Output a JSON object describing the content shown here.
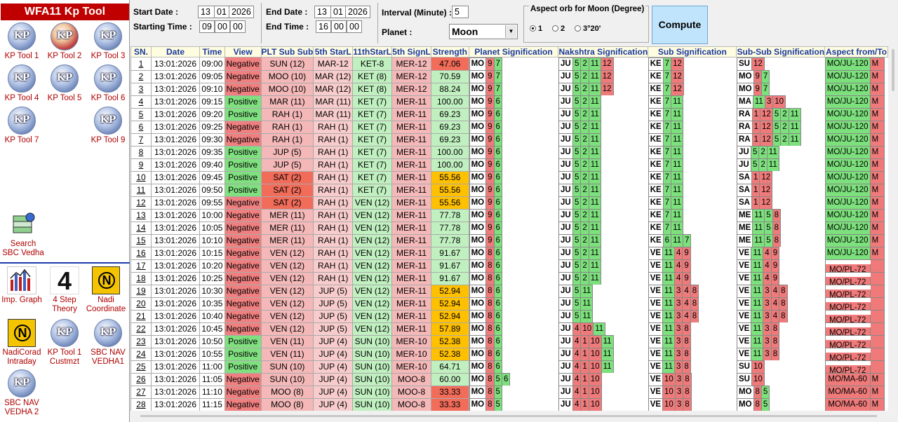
{
  "sidebar": {
    "title": "WFA11 Kp Tool",
    "tools": [
      {
        "label": "KP Tool 1"
      },
      {
        "label": "KP Tool 2"
      },
      {
        "label": "KP Tool 3"
      },
      {
        "label": "KP Tool 4"
      },
      {
        "label": "KP Tool 5"
      },
      {
        "label": "KP Tool 6"
      },
      {
        "label": "KP Tool 7"
      },
      {
        "label": "KP Tool 9"
      }
    ],
    "search_label_1": "Search",
    "search_label_2": "SBC Vedha",
    "bottom": [
      {
        "label1": "Imp. Graph",
        "label2": ""
      },
      {
        "label1": "4 Step",
        "label2": "Theory"
      },
      {
        "label1": "Nadi",
        "label2": "Coordinate"
      },
      {
        "label1": "NadiCorad",
        "label2": "Intraday"
      },
      {
        "label1": "KP Tool 1",
        "label2": "Custmzt"
      },
      {
        "label1": "SBC NAV",
        "label2": "VEDHA1"
      },
      {
        "label1": "SBC NAV",
        "label2": "VEDHA 2"
      }
    ],
    "kp_text": "KP",
    "four_text": "4",
    "n_text": "N"
  },
  "form": {
    "start_date_label": "Start Date :",
    "start_d": "13",
    "start_m": "01",
    "start_y": "2026",
    "starting_time_label": "Starting Time :",
    "start_h": "09",
    "start_min": "00",
    "start_s": "00",
    "end_date_label": "End Date :",
    "end_d": "13",
    "end_m": "01",
    "end_y": "2026",
    "end_time_label": "End Time :",
    "end_h": "16",
    "end_min": "00",
    "end_s": "00",
    "interval_label": "Interval (Minute) :",
    "interval": "5",
    "planet_label": "Planet :",
    "planet": "Moon",
    "orb_legend": "Aspect orb for Moon (Degree)",
    "orb_options": [
      "1",
      "2",
      "3°20'"
    ],
    "orb_selected": "1",
    "compute_label": "Compute"
  },
  "table": {
    "headers": [
      "SN.",
      "Date",
      "Time",
      "View",
      "PLT Sub",
      "Sub",
      "5th StarL",
      "11thStarL",
      "5th SignL",
      "Strength",
      "Planet Signification",
      "Nakshtra Signification",
      "Sub Signification",
      "Sub-Sub Signification",
      "Aspect from/To"
    ],
    "rows": [
      {
        "sn": "1",
        "date": "13:01:2026",
        "time": "09:00",
        "view": "Negative",
        "plt": "SUN (12)",
        "s5": "MAR-12",
        "s11": "KET-8",
        "sg5": "MER-12",
        "str": "47.06"
      },
      {
        "sn": "2",
        "date": "13:01:2026",
        "time": "09:05",
        "view": "Negative",
        "plt": "MOO (10)",
        "s5": "MAR (12)",
        "s11": "KET (8)",
        "sg5": "MER-12",
        "str": "70.59"
      },
      {
        "sn": "3",
        "date": "13:01:2026",
        "time": "09:10",
        "view": "Negative",
        "plt": "MOO (10)",
        "s5": "MAR (12)",
        "s11": "KET (8)",
        "sg5": "MER-12",
        "str": "88.24"
      },
      {
        "sn": "4",
        "date": "13:01:2026",
        "time": "09:15",
        "view": "Positive",
        "plt": "MAR (11)",
        "s5": "MAR (11)",
        "s11": "KET (7)",
        "sg5": "MER-11",
        "str": "100.00"
      },
      {
        "sn": "5",
        "date": "13:01:2026",
        "time": "09:20",
        "view": "Positive",
        "plt": "RAH (1)",
        "s5": "MAR (11)",
        "s11": "KET (7)",
        "sg5": "MER-11",
        "str": "69.23"
      },
      {
        "sn": "6",
        "date": "13:01:2026",
        "time": "09:25",
        "view": "Negative",
        "plt": "RAH (1)",
        "s5": "RAH (1)",
        "s11": "KET (7)",
        "sg5": "MER-11",
        "str": "69.23"
      },
      {
        "sn": "7",
        "date": "13:01:2026",
        "time": "09:30",
        "view": "Negative",
        "plt": "RAH (1)",
        "s5": "RAH (1)",
        "s11": "KET (7)",
        "sg5": "MER-11",
        "str": "69.23"
      },
      {
        "sn": "8",
        "date": "13:01:2026",
        "time": "09:35",
        "view": "Positive",
        "plt": "JUP (5)",
        "s5": "RAH (1)",
        "s11": "KET (7)",
        "sg5": "MER-11",
        "str": "100.00"
      },
      {
        "sn": "9",
        "date": "13:01:2026",
        "time": "09:40",
        "view": "Positive",
        "plt": "JUP (5)",
        "s5": "RAH (1)",
        "s11": "KET (7)",
        "sg5": "MER-11",
        "str": "100.00"
      },
      {
        "sn": "10",
        "date": "13:01:2026",
        "time": "09:45",
        "view": "Positive",
        "plt": "SAT (2)",
        "s5": "RAH (1)",
        "s11": "KET (7)",
        "sg5": "MER-11",
        "str": "55.56"
      },
      {
        "sn": "11",
        "date": "13:01:2026",
        "time": "09:50",
        "view": "Positive",
        "plt": "SAT (2)",
        "s5": "RAH (1)",
        "s11": "KET (7)",
        "sg5": "MER-11",
        "str": "55.56"
      },
      {
        "sn": "12",
        "date": "13:01:2026",
        "time": "09:55",
        "view": "Negative",
        "plt": "SAT (2)",
        "s5": "RAH (1)",
        "s11": "VEN (12)",
        "sg5": "MER-11",
        "str": "55.56"
      },
      {
        "sn": "13",
        "date": "13:01:2026",
        "time": "10:00",
        "view": "Negative",
        "plt": "MER (11)",
        "s5": "RAH (1)",
        "s11": "VEN (12)",
        "sg5": "MER-11",
        "str": "77.78"
      },
      {
        "sn": "14",
        "date": "13:01:2026",
        "time": "10:05",
        "view": "Negative",
        "plt": "MER (11)",
        "s5": "RAH (1)",
        "s11": "VEN (12)",
        "sg5": "MER-11",
        "str": "77.78"
      },
      {
        "sn": "15",
        "date": "13:01:2026",
        "time": "10:10",
        "view": "Negative",
        "plt": "MER (11)",
        "s5": "RAH (1)",
        "s11": "VEN (12)",
        "sg5": "MER-11",
        "str": "77.78"
      },
      {
        "sn": "16",
        "date": "13:01:2026",
        "time": "10:15",
        "view": "Negative",
        "plt": "VEN (12)",
        "s5": "RAH (1)",
        "s11": "VEN (12)",
        "sg5": "MER-11",
        "str": "91.67"
      },
      {
        "sn": "17",
        "date": "13:01:2026",
        "time": "10:20",
        "view": "Negative",
        "plt": "VEN (12)",
        "s5": "RAH (1)",
        "s11": "VEN (12)",
        "sg5": "MER-11",
        "str": "91.67"
      },
      {
        "sn": "18",
        "date": "13:01:2026",
        "time": "10:25",
        "view": "Negative",
        "plt": "VEN (12)",
        "s5": "RAH (1)",
        "s11": "VEN (12)",
        "sg5": "MER-11",
        "str": "91.67"
      },
      {
        "sn": "19",
        "date": "13:01:2026",
        "time": "10:30",
        "view": "Negative",
        "plt": "VEN (12)",
        "s5": "JUP (5)",
        "s11": "VEN (12)",
        "sg5": "MER-11",
        "str": "52.94"
      },
      {
        "sn": "20",
        "date": "13:01:2026",
        "time": "10:35",
        "view": "Negative",
        "plt": "VEN (12)",
        "s5": "JUP (5)",
        "s11": "VEN (12)",
        "sg5": "MER-11",
        "str": "52.94"
      },
      {
        "sn": "21",
        "date": "13:01:2026",
        "time": "10:40",
        "view": "Negative",
        "plt": "VEN (12)",
        "s5": "JUP (5)",
        "s11": "VEN (12)",
        "sg5": "MER-11",
        "str": "52.94"
      },
      {
        "sn": "22",
        "date": "13:01:2026",
        "time": "10:45",
        "view": "Negative",
        "plt": "VEN (12)",
        "s5": "JUP (5)",
        "s11": "VEN (12)",
        "sg5": "MER-11",
        "str": "57.89"
      },
      {
        "sn": "23",
        "date": "13:01:2026",
        "time": "10:50",
        "view": "Positive",
        "plt": "VEN (11)",
        "s5": "JUP (4)",
        "s11": "SUN (10)",
        "sg5": "MER-10",
        "str": "52.38"
      },
      {
        "sn": "24",
        "date": "13:01:2026",
        "time": "10:55",
        "view": "Positive",
        "plt": "VEN (11)",
        "s5": "JUP (4)",
        "s11": "SUN (10)",
        "sg5": "MER-10",
        "str": "52.38"
      },
      {
        "sn": "25",
        "date": "13:01:2026",
        "time": "11:00",
        "view": "Positive",
        "plt": "SUN (10)",
        "s5": "JUP (4)",
        "s11": "SUN (10)",
        "sg5": "MER-10",
        "str": "64.71"
      },
      {
        "sn": "26",
        "date": "13:01:2026",
        "time": "11:05",
        "view": "Negative",
        "plt": "SUN (10)",
        "s5": "JUP (4)",
        "s11": "SUN (10)",
        "sg5": "MOO-8",
        "str": "60.00"
      },
      {
        "sn": "27",
        "date": "13:01:2026",
        "time": "11:10",
        "view": "Negative",
        "plt": "MOO (8)",
        "s5": "JUP (4)",
        "s11": "SUN (10)",
        "sg5": "MOO-8",
        "str": "33.33"
      },
      {
        "sn": "28",
        "date": "13:01:2026",
        "time": "11:15",
        "view": "Negative",
        "plt": "MOO (8)",
        "s5": "JUP (4)",
        "s11": "SUN (10)",
        "sg5": "MOO-8",
        "str": "33.33"
      }
    ],
    "planet_sig": [
      [
        "MO",
        "9",
        "7"
      ],
      [
        "MO",
        "9",
        "7"
      ],
      [
        "MO",
        "9",
        "7"
      ],
      [
        "MO",
        "9",
        "6"
      ],
      [
        "MO",
        "9",
        "6"
      ],
      [
        "MO",
        "9",
        "6"
      ],
      [
        "MO",
        "9",
        "6"
      ],
      [
        "MO",
        "9",
        "6"
      ],
      [
        "MO",
        "9",
        "6"
      ],
      [
        "MO",
        "9",
        "6"
      ],
      [
        "MO",
        "9",
        "6"
      ],
      [
        "MO",
        "9",
        "6"
      ],
      [
        "MO",
        "9",
        "6"
      ],
      [
        "MO",
        "9",
        "6"
      ],
      [
        "MO",
        "9",
        "6"
      ],
      [
        "MO",
        "8",
        "6"
      ],
      [
        "MO",
        "8",
        "6"
      ],
      [
        "MO",
        "8",
        "6"
      ],
      [
        "MO",
        "8",
        "6"
      ],
      [
        "MO",
        "8",
        "6"
      ],
      [
        "MO",
        "8",
        "6"
      ],
      [
        "MO",
        "8",
        "6"
      ],
      [
        "MO",
        "8",
        "6"
      ],
      [
        "MO",
        "8",
        "6"
      ],
      [
        "MO",
        "8",
        "6"
      ],
      [
        "MO",
        "8",
        "5",
        "6"
      ],
      [
        "MO",
        "8",
        "5"
      ],
      [
        "MO",
        "8",
        "5"
      ]
    ],
    "nak_sig": [
      [
        "JU",
        "5",
        "2",
        "11",
        "12"
      ],
      [
        "JU",
        "5",
        "2",
        "11",
        "12"
      ],
      [
        "JU",
        "5",
        "2",
        "11",
        "12"
      ],
      [
        "JU",
        "5",
        "2",
        "11"
      ],
      [
        "JU",
        "5",
        "2",
        "11"
      ],
      [
        "JU",
        "5",
        "2",
        "11"
      ],
      [
        "JU",
        "5",
        "2",
        "11"
      ],
      [
        "JU",
        "5",
        "2",
        "11"
      ],
      [
        "JU",
        "5",
        "2",
        "11"
      ],
      [
        "JU",
        "5",
        "2",
        "11"
      ],
      [
        "JU",
        "5",
        "2",
        "11"
      ],
      [
        "JU",
        "5",
        "2",
        "11"
      ],
      [
        "JU",
        "5",
        "2",
        "11"
      ],
      [
        "JU",
        "5",
        "2",
        "11"
      ],
      [
        "JU",
        "5",
        "2",
        "11"
      ],
      [
        "JU",
        "5",
        "2",
        "11"
      ],
      [
        "JU",
        "5",
        "2",
        "11"
      ],
      [
        "JU",
        "5",
        "2",
        "11"
      ],
      [
        "JU",
        "5",
        "11"
      ],
      [
        "JU",
        "5",
        "11"
      ],
      [
        "JU",
        "5",
        "11"
      ],
      [
        "JU",
        "4",
        "10",
        "11"
      ],
      [
        "JU",
        "4",
        "1",
        "10",
        "11"
      ],
      [
        "JU",
        "4",
        "1",
        "10",
        "11"
      ],
      [
        "JU",
        "4",
        "1",
        "10",
        "11"
      ],
      [
        "JU",
        "4",
        "1",
        "10"
      ],
      [
        "JU",
        "4",
        "1",
        "10"
      ],
      [
        "JU",
        "4",
        "1",
        "10"
      ]
    ],
    "sub_sig": [
      [
        "KE",
        "7",
        "12"
      ],
      [
        "KE",
        "7",
        "12"
      ],
      [
        "KE",
        "7",
        "12"
      ],
      [
        "KE",
        "7",
        "11"
      ],
      [
        "KE",
        "7",
        "11"
      ],
      [
        "KE",
        "7",
        "11"
      ],
      [
        "KE",
        "7",
        "11"
      ],
      [
        "KE",
        "7",
        "11"
      ],
      [
        "KE",
        "7",
        "11"
      ],
      [
        "KE",
        "7",
        "11"
      ],
      [
        "KE",
        "7",
        "11"
      ],
      [
        "KE",
        "7",
        "11"
      ],
      [
        "KE",
        "7",
        "11"
      ],
      [
        "KE",
        "7",
        "11"
      ],
      [
        "KE",
        "6",
        "11",
        "7"
      ],
      [
        "VE",
        "11",
        "4",
        "9"
      ],
      [
        "VE",
        "11",
        "4",
        "9"
      ],
      [
        "VE",
        "11",
        "4",
        "9"
      ],
      [
        "VE",
        "11",
        "3",
        "4",
        "8"
      ],
      [
        "VE",
        "11",
        "3",
        "4",
        "8"
      ],
      [
        "VE",
        "11",
        "3",
        "4",
        "8"
      ],
      [
        "VE",
        "11",
        "3",
        "8"
      ],
      [
        "VE",
        "11",
        "3",
        "8"
      ],
      [
        "VE",
        "11",
        "3",
        "8"
      ],
      [
        "VE",
        "11",
        "3",
        "8"
      ],
      [
        "VE",
        "10",
        "3",
        "8"
      ],
      [
        "VE",
        "10",
        "3",
        "8"
      ],
      [
        "VE",
        "10",
        "3",
        "8"
      ]
    ],
    "subsub_sig": [
      [
        "SU",
        "12"
      ],
      [
        "MO",
        "9",
        "7"
      ],
      [
        "MO",
        "9",
        "7"
      ],
      [
        "MA",
        "11",
        "3",
        "10"
      ],
      [
        "RA",
        "1",
        "12",
        "5",
        "2",
        "11"
      ],
      [
        "RA",
        "1",
        "12",
        "5",
        "2",
        "11"
      ],
      [
        "RA",
        "1",
        "12",
        "5",
        "2",
        "11"
      ],
      [
        "JU",
        "5",
        "2",
        "11"
      ],
      [
        "JU",
        "5",
        "2",
        "11"
      ],
      [
        "SA",
        "1",
        "12"
      ],
      [
        "SA",
        "1",
        "12"
      ],
      [
        "SA",
        "1",
        "12"
      ],
      [
        "ME",
        "11",
        "5",
        "8"
      ],
      [
        "ME",
        "11",
        "5",
        "8"
      ],
      [
        "ME",
        "11",
        "5",
        "8"
      ],
      [
        "VE",
        "11",
        "4",
        "9"
      ],
      [
        "VE",
        "11",
        "4",
        "9"
      ],
      [
        "VE",
        "11",
        "4",
        "9"
      ],
      [
        "VE",
        "11",
        "3",
        "4",
        "8"
      ],
      [
        "VE",
        "11",
        "3",
        "4",
        "8"
      ],
      [
        "VE",
        "11",
        "3",
        "4",
        "8"
      ],
      [
        "VE",
        "11",
        "3",
        "8"
      ],
      [
        "VE",
        "11",
        "3",
        "8"
      ],
      [
        "VE",
        "11",
        "3",
        "8"
      ],
      [
        "SU",
        "10"
      ],
      [
        "SU",
        "10"
      ],
      [
        "MO",
        "8",
        "5"
      ],
      [
        "MO",
        "8",
        "5"
      ]
    ],
    "aspect": [
      [
        "MO/JU-120",
        "M"
      ],
      [
        "MO/JU-120",
        "M"
      ],
      [
        "MO/JU-120",
        "M"
      ],
      [
        "MO/JU-120",
        "M"
      ],
      [
        "MO/JU-120",
        "M"
      ],
      [
        "MO/JU-120",
        "M"
      ],
      [
        "MO/JU-120",
        "M"
      ],
      [
        "MO/JU-120",
        "M"
      ],
      [
        "MO/JU-120",
        "M"
      ],
      [
        "MO/JU-120",
        "M"
      ],
      [
        "MO/JU-120",
        "M"
      ],
      [
        "MO/JU-120",
        "M"
      ],
      [
        "MO/JU-120",
        "M"
      ],
      [
        "MO/JU-120",
        "M"
      ],
      [
        "MO/JU-120",
        "M"
      ],
      [
        "MO/JU-120",
        "M"
      ],
      [
        "MO/PL-72",
        ""
      ],
      [
        "MO/PL-72",
        ""
      ],
      [
        "MO/PL-72",
        ""
      ],
      [
        "MO/PL-72",
        ""
      ],
      [
        "MO/PL-72",
        ""
      ],
      [
        "MO/PL-72",
        ""
      ],
      [
        "MO/PL-72",
        ""
      ],
      [
        "MO/PL-72",
        ""
      ],
      [
        "MO/PL-72",
        ""
      ],
      [
        "MO/MA-60",
        "M"
      ],
      [
        "MO/MA-60",
        "M"
      ],
      [
        "MO/MA-60",
        "M"
      ]
    ]
  }
}
